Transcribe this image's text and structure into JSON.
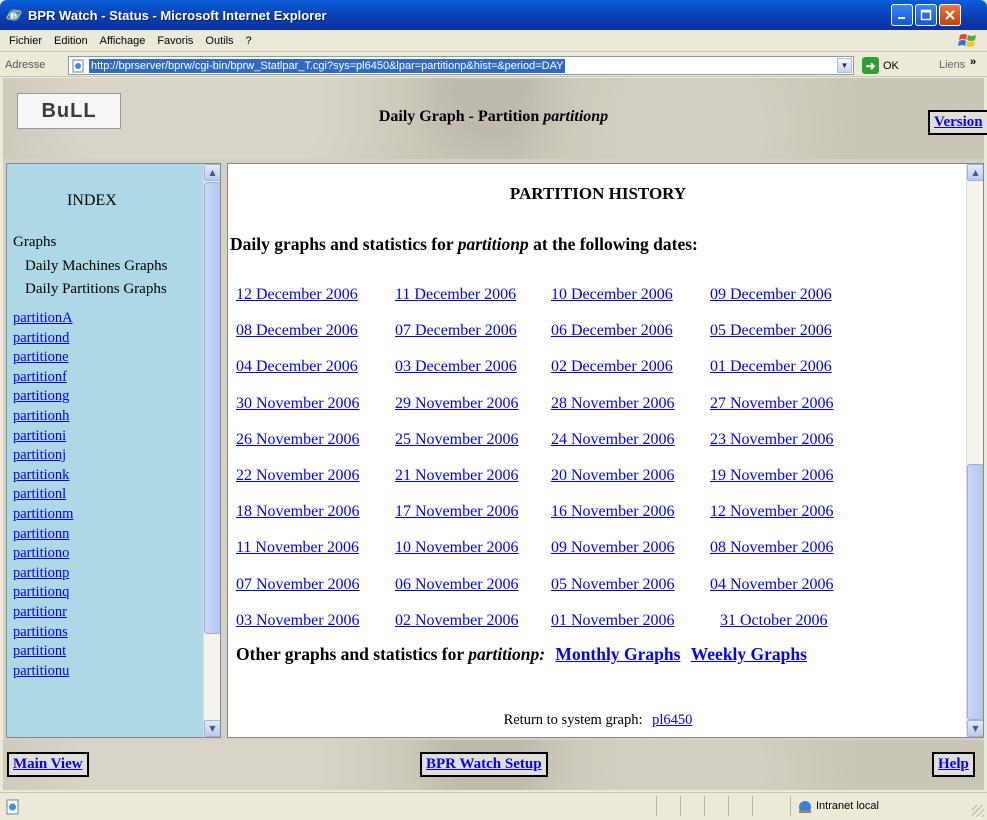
{
  "window": {
    "title": "BPR Watch - Status - Microsoft Internet Explorer"
  },
  "menu": [
    "Fichier",
    "Edition",
    "Affichage",
    "Favoris",
    "Outils",
    "?"
  ],
  "address": {
    "label": "Adresse",
    "url": "http://bprserver/bprw/cgi-bin/bprw_Statlpar_T.cgi?sys=pl6450&lpar=partitionp&hist=&period=DAY",
    "go_label": "OK",
    "links_label": "Liens"
  },
  "banner": {
    "logo_text": "BuLL",
    "title_prefix": "Daily Graph - Partition ",
    "title_partition": "partitionp",
    "version_button": "Version"
  },
  "left": {
    "index_title": "INDEX",
    "graphs_heading": "Graphs",
    "daily_machines": "Daily Machines Graphs",
    "daily_partitions": "Daily Partitions Graphs",
    "partitions": [
      "partitionA",
      "partitiond",
      "partitione",
      "partitionf",
      "partitiong",
      "partitionh",
      "partitioni",
      "partitionj",
      "partitionk",
      "partitionl",
      "partitionm",
      "partitionn",
      "partitiono",
      "partitionp",
      "partitionq",
      "partitionr",
      "partitions",
      "partitiont",
      "partitionu"
    ]
  },
  "main": {
    "heading": "PARTITION HISTORY",
    "intro_prefix": "Daily graphs and statistics for ",
    "intro_partition": "partitionp",
    "intro_suffix": " at the following dates:",
    "date_rows": [
      [
        "12 December 2006",
        "11 December 2006",
        "10 December 2006",
        "09 December 2006"
      ],
      [
        "08 December 2006",
        "07 December 2006",
        "06 December 2006",
        "05 December 2006"
      ],
      [
        "04 December 2006",
        "03 December 2006",
        "02 December 2006",
        "01 December 2006"
      ],
      [
        "30 November 2006",
        "29 November 2006",
        "28 November 2006",
        "27 November 2006"
      ],
      [
        "26 November 2006",
        "25 November 2006",
        "24 November 2006",
        "23 November 2006"
      ],
      [
        "22 November 2006",
        "21 November 2006",
        "20 November 2006",
        "19 November 2006"
      ],
      [
        "18 November 2006",
        "17 November 2006",
        "16 November 2006",
        "12 November 2006"
      ],
      [
        "11 November 2006",
        "10 November 2006",
        "09 November 2006",
        "08 November 2006"
      ],
      [
        "07 November 2006",
        "06 November 2006",
        "05 November 2006",
        "04 November 2006"
      ],
      [
        "03 November 2006",
        "02 November 2006",
        "01 November 2006",
        "31 October 2006"
      ]
    ],
    "other_prefix": "Other graphs and statistics for ",
    "other_partition": "partitionp:",
    "monthly_link": "Monthly Graphs",
    "weekly_link": "Weekly Graphs",
    "return_label": "Return to system graph:",
    "return_link": "pl6450"
  },
  "footer": {
    "main_view": "Main View",
    "setup": "BPR Watch Setup",
    "help": "Help"
  },
  "status": {
    "zone": "Intranet local"
  }
}
